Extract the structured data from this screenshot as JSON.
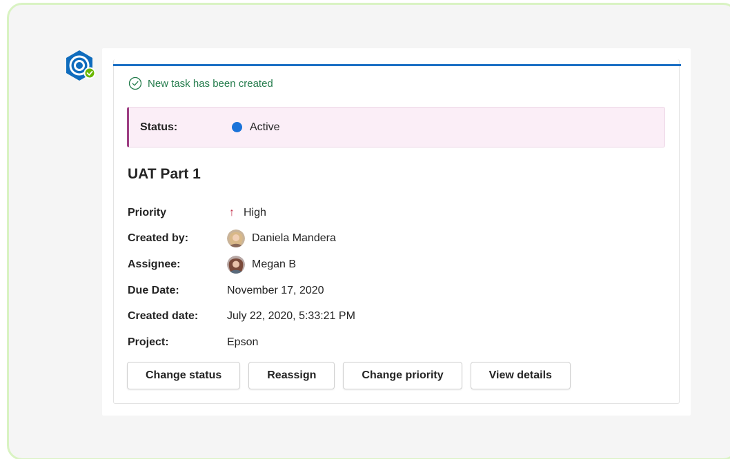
{
  "notice": {
    "text": "New task has been created",
    "color": "#237b4b"
  },
  "status": {
    "label": "Status:",
    "value": "Active",
    "dot_color": "#1a73d9",
    "accent": "#9e3f83"
  },
  "task": {
    "title": "UAT Part 1"
  },
  "facts": [
    {
      "label": "Priority",
      "value": "High",
      "icon": "arrow-up-icon"
    },
    {
      "label": "Created by:",
      "value": "Daniela Mandera",
      "icon": "avatar"
    },
    {
      "label": "Assignee:",
      "value": "Megan B",
      "icon": "avatar"
    },
    {
      "label": "Due Date:",
      "value": "November 17, 2020"
    },
    {
      "label": "Created date:",
      "value": "July 22, 2020, 5:33:21 PM"
    },
    {
      "label": "Project:",
      "value": "Epson"
    }
  ],
  "actions": [
    "Change status",
    "Reassign",
    "Change priority",
    "View details"
  ],
  "colors": {
    "card_accent": "#1a6fc4",
    "frame_border": "#d9f3c2",
    "bot_brand": "#0f6cbd",
    "bot_badge": "#6bb700"
  },
  "bot": {
    "icon": "bot-avatar-icon"
  }
}
